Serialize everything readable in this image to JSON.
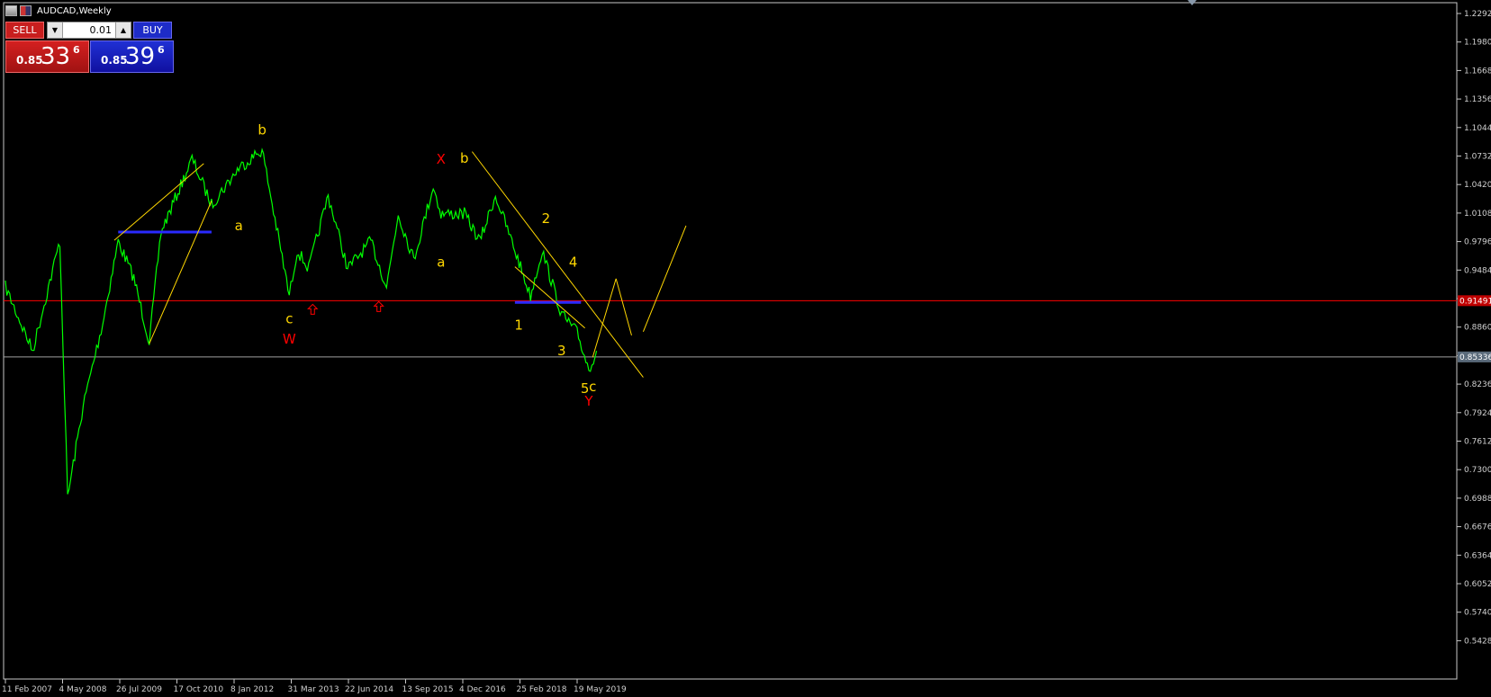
{
  "window": {
    "title": "AUDCAD,Weekly",
    "icons": [
      "chart-window-icon",
      "flag-icon"
    ]
  },
  "trade_panel": {
    "sell_label": "SELL",
    "buy_label": "BUY",
    "lot_value": "0.01",
    "sell_price": {
      "small": "0.85",
      "big": "33",
      "sup": "6"
    },
    "buy_price": {
      "small": "0.85",
      "big": "39",
      "sup": "6"
    },
    "colors": {
      "sell": "#c81e1e",
      "buy": "#1e2cc8"
    }
  },
  "price_axis": {
    "labels": [
      "1.22920",
      "1.19800",
      "1.16680",
      "1.13560",
      "1.10440",
      "1.07320",
      "1.04200",
      "1.01080",
      "0.97960",
      "0.94840",
      "0.91720",
      "0.88600",
      "0.85480",
      "0.82360",
      "0.79240",
      "0.76120",
      "0.73000",
      "0.69880",
      "0.66760",
      "0.63640",
      "0.60520",
      "0.57400",
      "0.54280"
    ],
    "top_value": 1.2292,
    "step": 0.0312
  },
  "time_axis": {
    "labels": [
      "11 Feb 2007",
      "4 May 2008",
      "26 Jul 2009",
      "17 Oct 2010",
      "8 Jan 2012",
      "31 Mar 2013",
      "22 Jun 2014",
      "13 Sep 2015",
      "4 Dec 2016",
      "25 Feb 2018",
      "19 May 2019"
    ]
  },
  "price_lines": {
    "red_line": {
      "label": "0.91491",
      "value": 0.91491,
      "color": "#ff0000"
    },
    "gray_line": {
      "label": "0.85336",
      "value": 0.85336,
      "color": "#a0a0a0"
    }
  },
  "chart_data": {
    "type": "line",
    "symbol": "AUDCAD",
    "timeframe": "Weekly",
    "x": [
      "2007-02",
      "2007-09",
      "2008-04",
      "2008-06",
      "2008-10",
      "2009-03",
      "2009-07",
      "2009-11",
      "2010-03",
      "2010-06",
      "2010-10",
      "2011-02",
      "2011-07",
      "2012-02",
      "2012-08",
      "2013-03",
      "2013-05",
      "2013-08",
      "2014-01",
      "2014-06",
      "2014-12",
      "2015-04",
      "2015-07",
      "2015-11",
      "2016-04",
      "2016-06",
      "2016-12",
      "2017-04",
      "2017-08",
      "2018-01",
      "2018-05",
      "2018-08",
      "2019-01",
      "2019-05",
      "2019-08",
      "2019-10"
    ],
    "values": [
      0.93,
      0.86,
      0.98,
      0.7,
      0.8,
      0.89,
      0.98,
      0.94,
      0.87,
      0.99,
      1.03,
      1.07,
      1.02,
      1.06,
      1.08,
      0.92,
      0.97,
      0.95,
      1.03,
      0.95,
      0.98,
      0.93,
      1.01,
      0.96,
      1.04,
      1.01,
      1.01,
      0.98,
      1.03,
      0.97,
      0.92,
      0.97,
      0.9,
      0.88,
      0.84,
      0.86
    ],
    "series_color": "#00ff00",
    "ylim": [
      0.5176,
      1.2292
    ],
    "grid": false,
    "wave_labels": [
      {
        "text": "b",
        "x": "2012-08",
        "y": 1.097,
        "color": "#ffd700"
      },
      {
        "text": "a",
        "x": "2012-02",
        "y": 0.992,
        "color": "#ffd700"
      },
      {
        "text": "c",
        "x": "2013-03",
        "y": 0.89,
        "color": "#ffd700"
      },
      {
        "text": "W",
        "x": "2013-03",
        "y": 0.868,
        "color": "#ff0000"
      },
      {
        "text": "X",
        "x": "2016-06",
        "y": 1.065,
        "color": "#ff0000"
      },
      {
        "text": "b",
        "x": "2016-12",
        "y": 1.066,
        "color": "#ffd700"
      },
      {
        "text": "a",
        "x": "2016-06",
        "y": 0.952,
        "color": "#ffd700"
      },
      {
        "text": "2",
        "x": "2018-09",
        "y": 1.0,
        "color": "#ffd700"
      },
      {
        "text": "4",
        "x": "2019-04",
        "y": 0.952,
        "color": "#ffd700"
      },
      {
        "text": "1",
        "x": "2018-02",
        "y": 0.883,
        "color": "#ffd700"
      },
      {
        "text": "3",
        "x": "2019-01",
        "y": 0.855,
        "color": "#ffd700"
      },
      {
        "text": "5",
        "x": "2019-07",
        "y": 0.814,
        "color": "#ffd700"
      },
      {
        "text": "c",
        "x": "2019-09",
        "y": 0.816,
        "color": "#ffd700"
      },
      {
        "text": "Y",
        "x": "2019-08",
        "y": 0.8,
        "color": "#ff0000"
      }
    ],
    "arrows": [
      {
        "x": "2013-09",
        "y": 0.905,
        "color": "#ff0000"
      },
      {
        "x": "2015-02",
        "y": 0.908,
        "color": "#ff0000"
      }
    ],
    "trendlines": [
      {
        "from": [
          "2009-06",
          0.981
        ],
        "to": [
          "2011-05",
          1.065
        ],
        "color": "#ffd700"
      },
      {
        "from": [
          "2010-03",
          0.868
        ],
        "to": [
          "2011-07",
          1.024
        ],
        "color": "#ffd700"
      },
      {
        "from": [
          "2017-02",
          1.078
        ],
        "to": [
          "2020-10",
          0.831
        ],
        "color": "#ffd700"
      },
      {
        "from": [
          "2018-01",
          0.952
        ],
        "to": [
          "2019-07",
          0.885
        ],
        "color": "#ffd700"
      },
      {
        "from": [
          "2019-09",
          0.853
        ],
        "to": [
          "2020-03",
          0.939
        ],
        "color": "#ffd700"
      },
      {
        "from": [
          "2020-03",
          0.939
        ],
        "to": [
          "2020-07",
          0.877
        ],
        "color": "#ffd700"
      },
      {
        "from": [
          "2020-10",
          0.881
        ],
        "to": [
          "2021-09",
          0.997
        ],
        "color": "#ffd700"
      }
    ],
    "support_segments": [
      {
        "from": [
          "2009-07",
          0.99
        ],
        "to": [
          "2011-07",
          0.99
        ],
        "color": "#2a2aff"
      },
      {
        "from": [
          "2018-01",
          0.913
        ],
        "to": [
          "2019-06",
          0.913
        ],
        "color": "#2a2aff"
      }
    ]
  }
}
